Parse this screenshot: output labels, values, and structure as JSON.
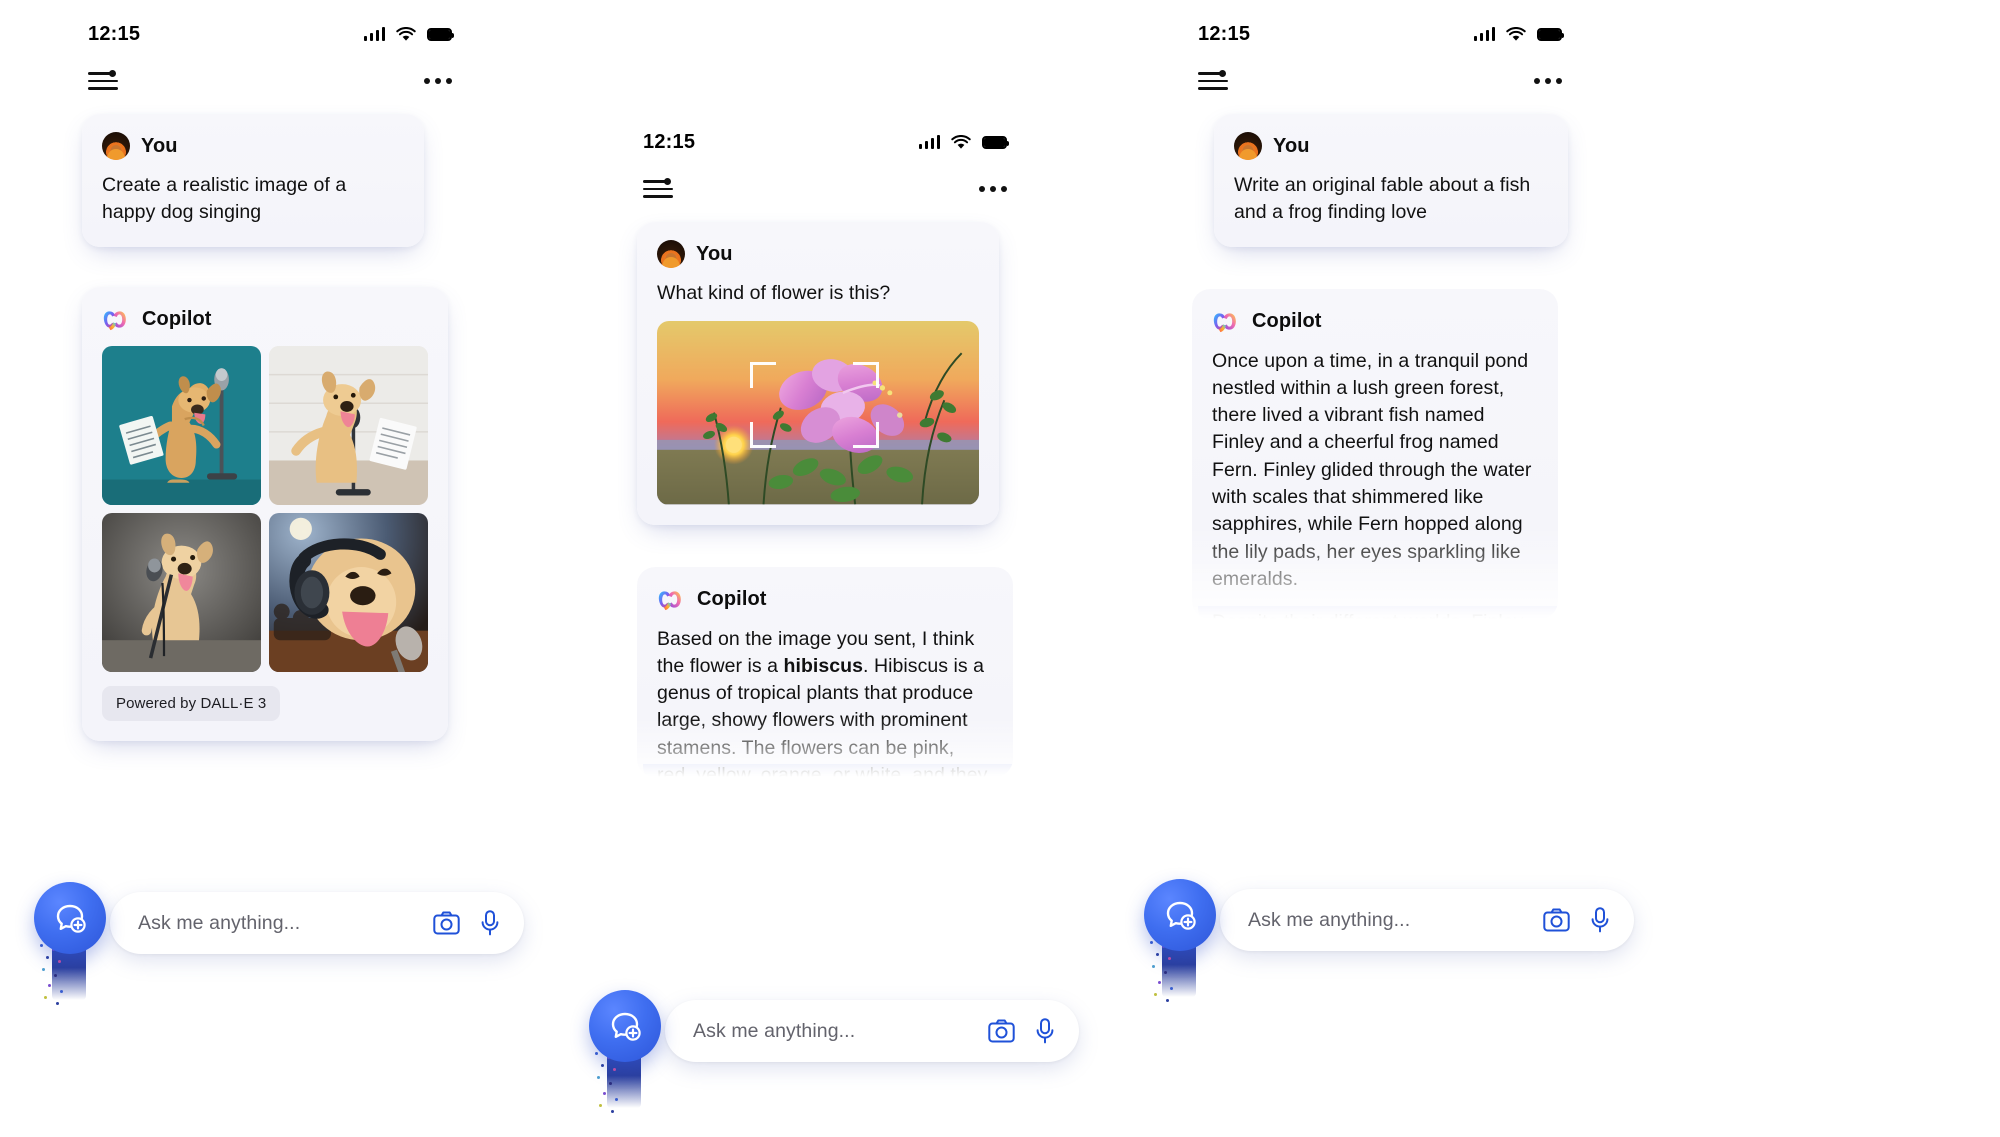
{
  "app": {
    "name": "Copilot",
    "assistant_label": "Copilot",
    "user_label": "You"
  },
  "status": {
    "time": "12:15",
    "signal_icon": "cellular-signal-icon",
    "wifi_icon": "wifi-icon",
    "battery_icon": "battery-full-icon"
  },
  "nav": {
    "menu_icon": "sidebar-menu-icon",
    "more_icon": "more-options-icon"
  },
  "composer": {
    "placeholder": "Ask me anything...",
    "camera_icon": "camera-icon",
    "mic_icon": "microphone-icon",
    "fab_icon": "new-chat-bubble-icon"
  },
  "screens": [
    {
      "id": "image-generation",
      "user_message": "Create a realistic image of a happy dog singing",
      "assistant": {
        "name": "Copilot",
        "image_count": 4,
        "images": [
          {
            "alt": "dog singing with sheet music on teal background"
          },
          {
            "alt": "dog singing at microphone with sheet music"
          },
          {
            "alt": "dog singing into microphone on grey stage"
          },
          {
            "alt": "dog with headphones singing into microphone"
          }
        ],
        "attribution_badge": "Powered by DALL·E 3"
      }
    },
    {
      "id": "image-understanding",
      "user_message": "What kind of flower is this?",
      "user_image_alt": "purple hibiscus flowers at sunset",
      "assistant": {
        "name": "Copilot",
        "text_lead": "Based on the image you sent, I think the flower is a ",
        "text_bold": "hibiscus",
        "text_rest": ". Hibiscus is a genus of tropical plants that produce large, showy flowers with prominent stamens. The flowers can be pink, red, yellow, orange, or white, and they often have a contrasting eye in the"
      }
    },
    {
      "id": "creative-writing",
      "user_message": "Write an original fable about a fish and a frog finding love",
      "assistant": {
        "name": "Copilot",
        "paragraph_1": "Once upon a time, in a tranquil pond nestled within a lush green forest, there lived a vibrant fish named Finley and a cheerful frog named Fern. Finley glided through the water with scales that shimmered like sapphires, while Fern hopped along the lily pads, her eyes sparkling like emeralds.",
        "paragraph_2": "Despite their different worlds, Finley and Fern shared a love for the pond's melody at dusk. Each evening, as the sun dipped below"
      }
    }
  ],
  "colors": {
    "accent_blue": "#2d55d8",
    "bubble_bg": "#f5f5fa",
    "badge_bg": "#e7e7ef",
    "text_primary": "#111111",
    "placeholder": "#63636c"
  }
}
